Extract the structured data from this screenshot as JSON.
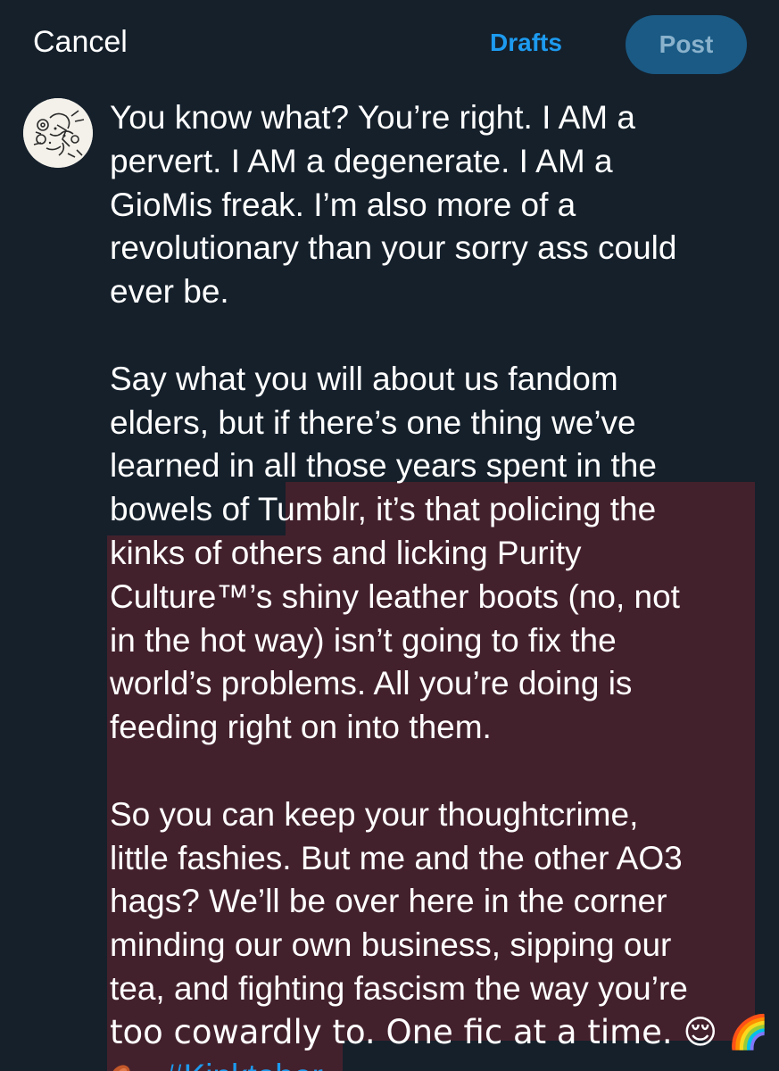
{
  "header": {
    "cancel_label": "Cancel",
    "drafts_label": "Drafts",
    "post_label": "Post"
  },
  "compose": {
    "paragraphs": [
      {
        "lines": [
          "You know what? You’re right. I AM a",
          "pervert. I AM a degenerate. I AM a",
          "GioMis freak. I’m also more of a",
          "revolutionary than your sorry ass could",
          "ever be."
        ]
      },
      {
        "lines": [
          "Say what you will about us fandom",
          "elders, but if there’s one thing we’ve",
          "learned in all those years spent in the",
          "bowels of Tumblr, it’s that policing the",
          "kinks of others and licking Purity",
          "Culture™’s shiny leather boots (no, not",
          "in the hot way) isn’t going to fix the",
          "world’s problems. All you’re doing is",
          "feeding right on into them."
        ]
      },
      {
        "lines": [
          "So you can keep your thoughtcrime,",
          "little fashies. But me and the other AO3",
          "hags? We’ll be over here in the corner",
          "minding our own business, sipping our",
          "tea, and fighting fascism the way you’re",
          "too cowardly to. One fic at a time. 😌 🌈"
        ]
      }
    ],
    "hashtag": "#Kinktober"
  },
  "colors": {
    "background": "#15202b",
    "accent": "#1d9bf0",
    "post_button": "#1a5a85",
    "text_highlight": "#43212c"
  },
  "icons": {
    "avatar": "sketch-avatar",
    "meat": "meat-on-bone-emoji"
  }
}
